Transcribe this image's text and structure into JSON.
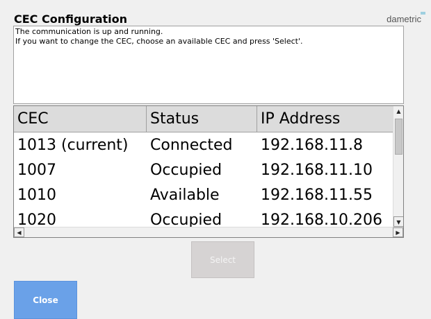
{
  "header": {
    "title": "CEC Configuration",
    "brand": "dametric"
  },
  "message": {
    "line1": "The communication is up and running.",
    "line2": "If you want to change the CEC, choose an available CEC and press 'Select'."
  },
  "table": {
    "columns": [
      "CEC",
      "Status",
      "IP Address"
    ],
    "rows": [
      {
        "cec": "1013 (current)",
        "status": "Connected",
        "ip": "192.168.11.8"
      },
      {
        "cec": "1007",
        "status": "Occupied",
        "ip": "192.168.11.10"
      },
      {
        "cec": "1010",
        "status": "Available",
        "ip": "192.168.11.55"
      },
      {
        "cec": "1020",
        "status": "Occupied",
        "ip": "192.168.10.206"
      }
    ]
  },
  "buttons": {
    "select": "Select",
    "close": "Close"
  },
  "colors": {
    "close_button": "#6aa1e8",
    "select_button_disabled": "#d6d3d3",
    "header_row": "#dcdcdc"
  }
}
